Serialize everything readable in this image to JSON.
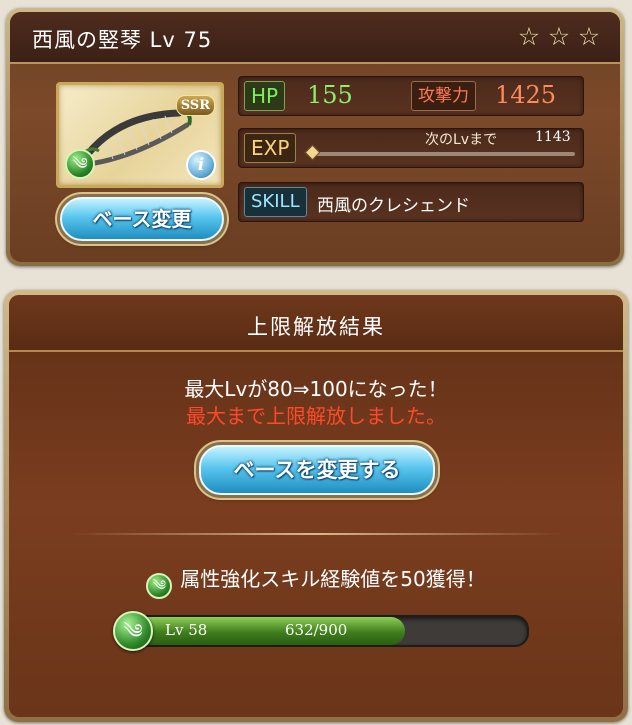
{
  "weapon": {
    "title": "西風の竪琴 Lv 75",
    "rarity_badge": "SSR",
    "element_icon": "wind-element-icon",
    "info_glyph": "i",
    "stars": [
      "☆",
      "☆",
      "☆"
    ],
    "base_change_label": "ベース変更"
  },
  "stats": {
    "hp_label": "HP",
    "hp_value": "155",
    "atk_label": "攻撃力",
    "atk_value": "1425",
    "exp_label": "EXP",
    "next_label": "次のLvまで",
    "next_value": "1143",
    "skill_label": "SKILL",
    "skill_name": "西風のクレシェンド"
  },
  "result": {
    "title": "上限解放結果",
    "message_max_level": "最大Lvが80⇒100になった！",
    "message_limit": "最大まで上限解放しました。",
    "change_base_button": "ベースを変更する",
    "skill_exp_gain": "属性強化スキル経験値を50獲得！",
    "level_label": "Lv 58",
    "progress_text": "632/900",
    "progress_fraction": 0.702
  },
  "colors": {
    "hp": "#8af06a",
    "attack": "#ff8a5a",
    "limit_message": "#ff4a2a",
    "wind_element": "#2f8a2a"
  }
}
